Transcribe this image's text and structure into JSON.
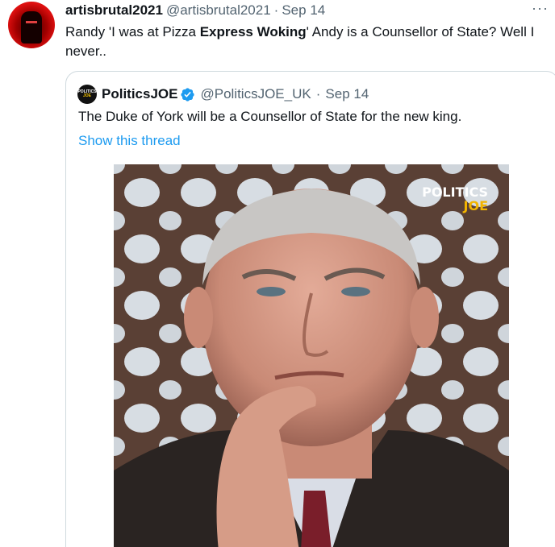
{
  "tweet": {
    "author_name": "artisbrutal2021",
    "handle": "@artisbrutal2021",
    "separator": "·",
    "date": "Sep 14",
    "more_icon": "more-horizontal-icon",
    "more_glyph": "···",
    "text_part1": "Randy 'I was at Pizza ",
    "text_bold": "Express Woking",
    "text_part2": "' Andy is a Counsellor of State?  Well I never.."
  },
  "quote": {
    "avatar_line1": "POLITICS",
    "avatar_line2": "JOE",
    "author_name": "PoliticsJOE",
    "handle": "@PoliticsJOE_UK",
    "separator": "·",
    "date": "Sep 14",
    "text": "The Duke of York will be a Counsellor of State for the new king.",
    "show_thread": "Show this thread",
    "verified_icon": "verified-badge-icon"
  },
  "photo": {
    "brand_line1": "POLITICS",
    "brand_line2": "JOE"
  },
  "colors": {
    "link": "#1d9bf0",
    "secondary_text": "#536471",
    "border": "#cfd9de",
    "verified": "#1d9bf0",
    "brand_yellow": "#f2b400"
  }
}
